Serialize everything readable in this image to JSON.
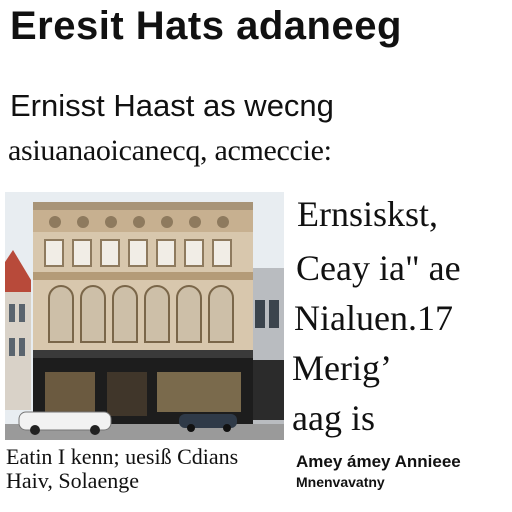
{
  "headline": "Eresit Hats adaneeg",
  "subheading": {
    "line1": "Ernisst Haast as wecng",
    "line2": "asiuanaoicanecq, acmeccie:"
  },
  "side_text": [
    "Ernsiskst,",
    "Ceay ia\" ae",
    "Nialuen.17",
    "Merig’",
    "aag is"
  ],
  "caption_left": {
    "line1": "Eatin I kenn; uesiß Cdians",
    "line2": "Haiv, Solaenge"
  },
  "caption_right": {
    "line1": "Amey ámey Annieee",
    "line2": "Mnenvavatny"
  },
  "colors": {
    "background": "#ffffff",
    "text": "#111111",
    "facade": "#d8c7ad",
    "storefront": "#1d1d1d"
  }
}
